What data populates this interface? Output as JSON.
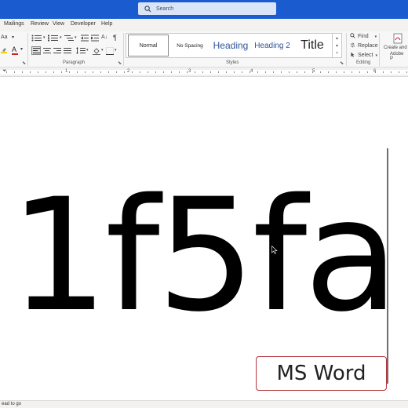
{
  "search": {
    "placeholder": "Search",
    "icon": "search-icon"
  },
  "menu": {
    "tabs": [
      "Mailings",
      "Review",
      "View",
      "Developer",
      "Help"
    ]
  },
  "ribbon": {
    "groups": {
      "paragraph": "Paragraph",
      "styles": "Styles",
      "editing": "Editing"
    },
    "font_size_label": "Aa",
    "pilcrow": "¶",
    "styles": {
      "normal": "Normal",
      "no_spacing": "No Spacing",
      "heading1": "Heading",
      "heading2": "Heading 2",
      "title": "Title"
    },
    "editing": {
      "find": "Find",
      "replace": "Replace",
      "select": "Select"
    },
    "create_adobe_line1": "Create and",
    "create_adobe_line2": "Adobe P"
  },
  "ruler": {
    "numbers": [
      "1",
      "2",
      "3",
      "4",
      "5",
      "6"
    ]
  },
  "document": {
    "big_text": "1f5fa",
    "badge": "MS Word"
  },
  "status": {
    "text": "ead to go"
  },
  "colors": {
    "titlebar": "#1a5bd0",
    "badge_border": "#b2343b"
  }
}
